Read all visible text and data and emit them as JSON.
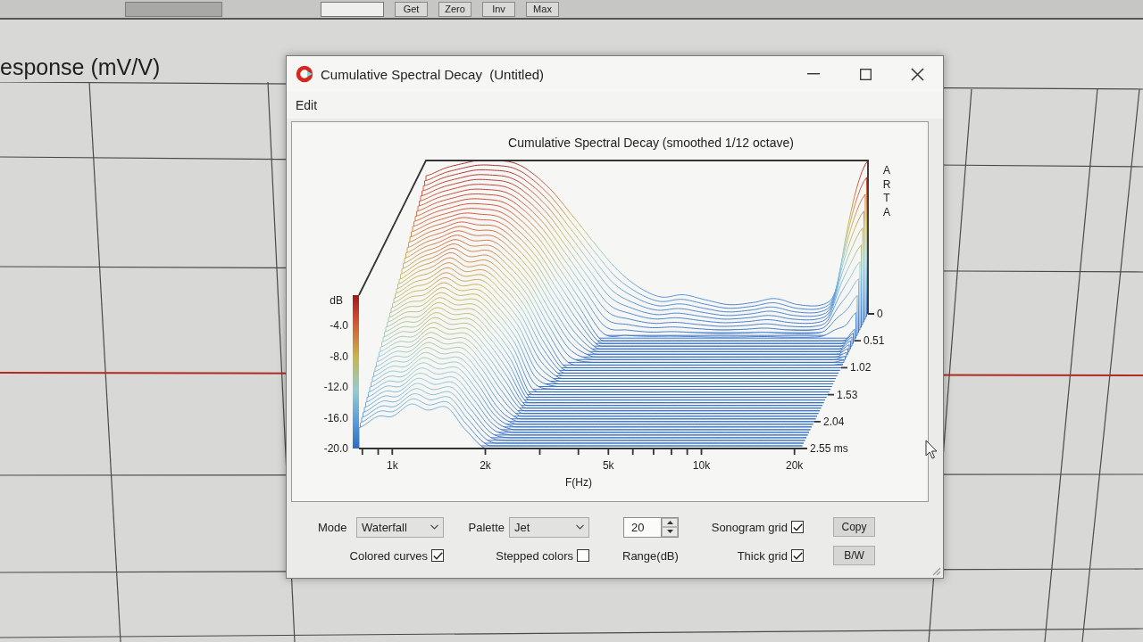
{
  "toolbar": {
    "buttons": [
      "Get",
      "Zero",
      "Inv",
      "Max"
    ]
  },
  "background_plot": {
    "title": "esponse (mV/V)"
  },
  "dialog": {
    "title": "Cumulative Spectral Decay  (Untitled)",
    "menu": [
      "Edit"
    ],
    "chart": {
      "title": "Cumulative Spectral Decay (smoothed 1/12 octave)",
      "y_label": "dB",
      "y_ticks": [
        "-4.0",
        "-8.0",
        "-12.0",
        "-16.0",
        "-20.0"
      ],
      "x_label": "F(Hz)",
      "x_ticks": [
        "1k",
        "2k",
        "5k",
        "10k",
        "20k"
      ],
      "time_ticks": [
        "0",
        "0.51",
        "1.02",
        "1.53",
        "2.04",
        "2.55 ms"
      ],
      "corner_label": "ARTA"
    },
    "controls": {
      "mode": {
        "label": "Mode",
        "value": "Waterfall"
      },
      "palette": {
        "label": "Palette",
        "value": "Jet"
      },
      "range": {
        "value": "20",
        "label": "Range(dB)"
      },
      "checkboxes": [
        {
          "label": "Sonogram grid",
          "checked": true
        },
        {
          "label": "Colored curves",
          "checked": true
        },
        {
          "label": "Stepped colors",
          "checked": false
        },
        {
          "label": "Thick grid",
          "checked": true
        }
      ],
      "buttons": [
        "Copy",
        "B/W"
      ]
    }
  }
}
